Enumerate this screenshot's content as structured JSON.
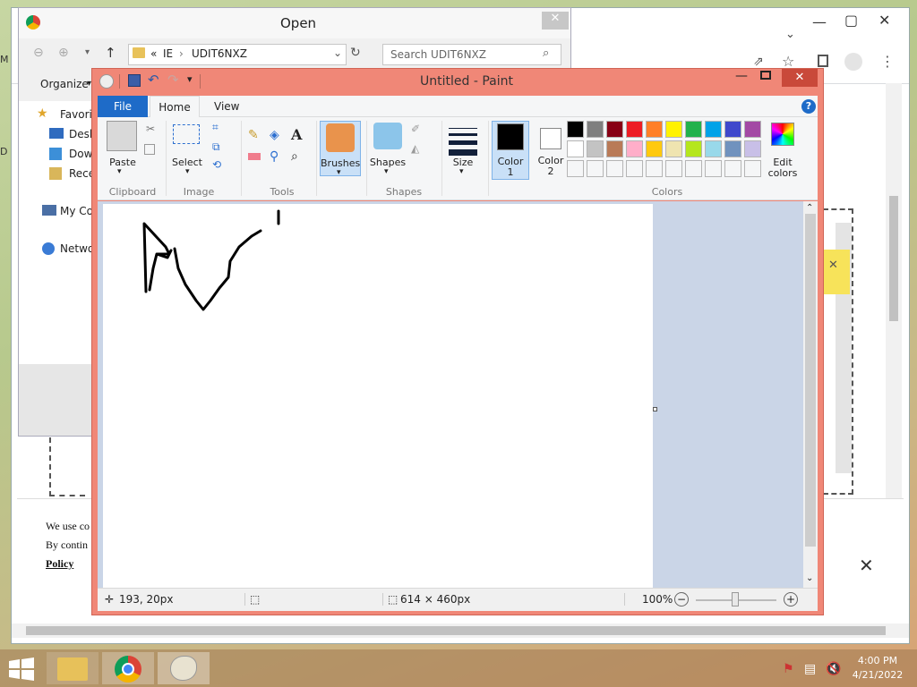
{
  "chrome": {
    "cookie_line1": "We use co",
    "cookie_line2": "By contin",
    "policy": "Policy",
    "close_glyph": "✕",
    "min_glyph": "—",
    "max_glyph": "▢",
    "closewin_glyph": "✕"
  },
  "open_dialog": {
    "title": "Open",
    "breadcrumb_prefix": "«",
    "breadcrumb_1": "IE",
    "breadcrumb_2": "UDIT6NXZ",
    "search_placeholder": "Search UDIT6NXZ",
    "organize": "Organize",
    "nav": [
      "Favorit",
      "Desk",
      "Dow",
      "Rece",
      "My Co",
      "Netwo"
    ]
  },
  "paint": {
    "title": "Untitled - Paint",
    "tabs": {
      "file": "File",
      "home": "Home",
      "view": "View"
    },
    "clipboard": {
      "paste": "Paste",
      "label": "Clipboard"
    },
    "image": {
      "select": "Select",
      "label": "Image"
    },
    "tools": {
      "label": "Tools"
    },
    "brushes": "Brushes",
    "shapes": {
      "button": "Shapes",
      "label": "Shapes"
    },
    "size": "Size",
    "color1": "Color 1",
    "color1_a": "Color",
    "color1_b": "1",
    "color2_a": "Color",
    "color2_b": "2",
    "colors_label": "Colors",
    "edit_colors_a": "Edit",
    "edit_colors_b": "colors",
    "palette_row1": [
      "#000000",
      "#7f7f7f",
      "#880015",
      "#ed1c24",
      "#ff7f27",
      "#fff200",
      "#22b14c",
      "#00a2e8",
      "#3f48cc",
      "#a349a4"
    ],
    "palette_row2": [
      "#ffffff",
      "#c3c3c3",
      "#b97a57",
      "#ffaec9",
      "#ffc90e",
      "#efe4b0",
      "#b5e61d",
      "#99d9ea",
      "#7092be",
      "#c8bfe7"
    ],
    "status": {
      "cursor_pos": "193, 20px",
      "canvas_size": "614 × 460px",
      "zoom": "100%",
      "zoom_out": "−",
      "zoom_in": "+"
    }
  },
  "taskbar": {
    "time": "4:00 PM",
    "date": "4/21/2022"
  }
}
